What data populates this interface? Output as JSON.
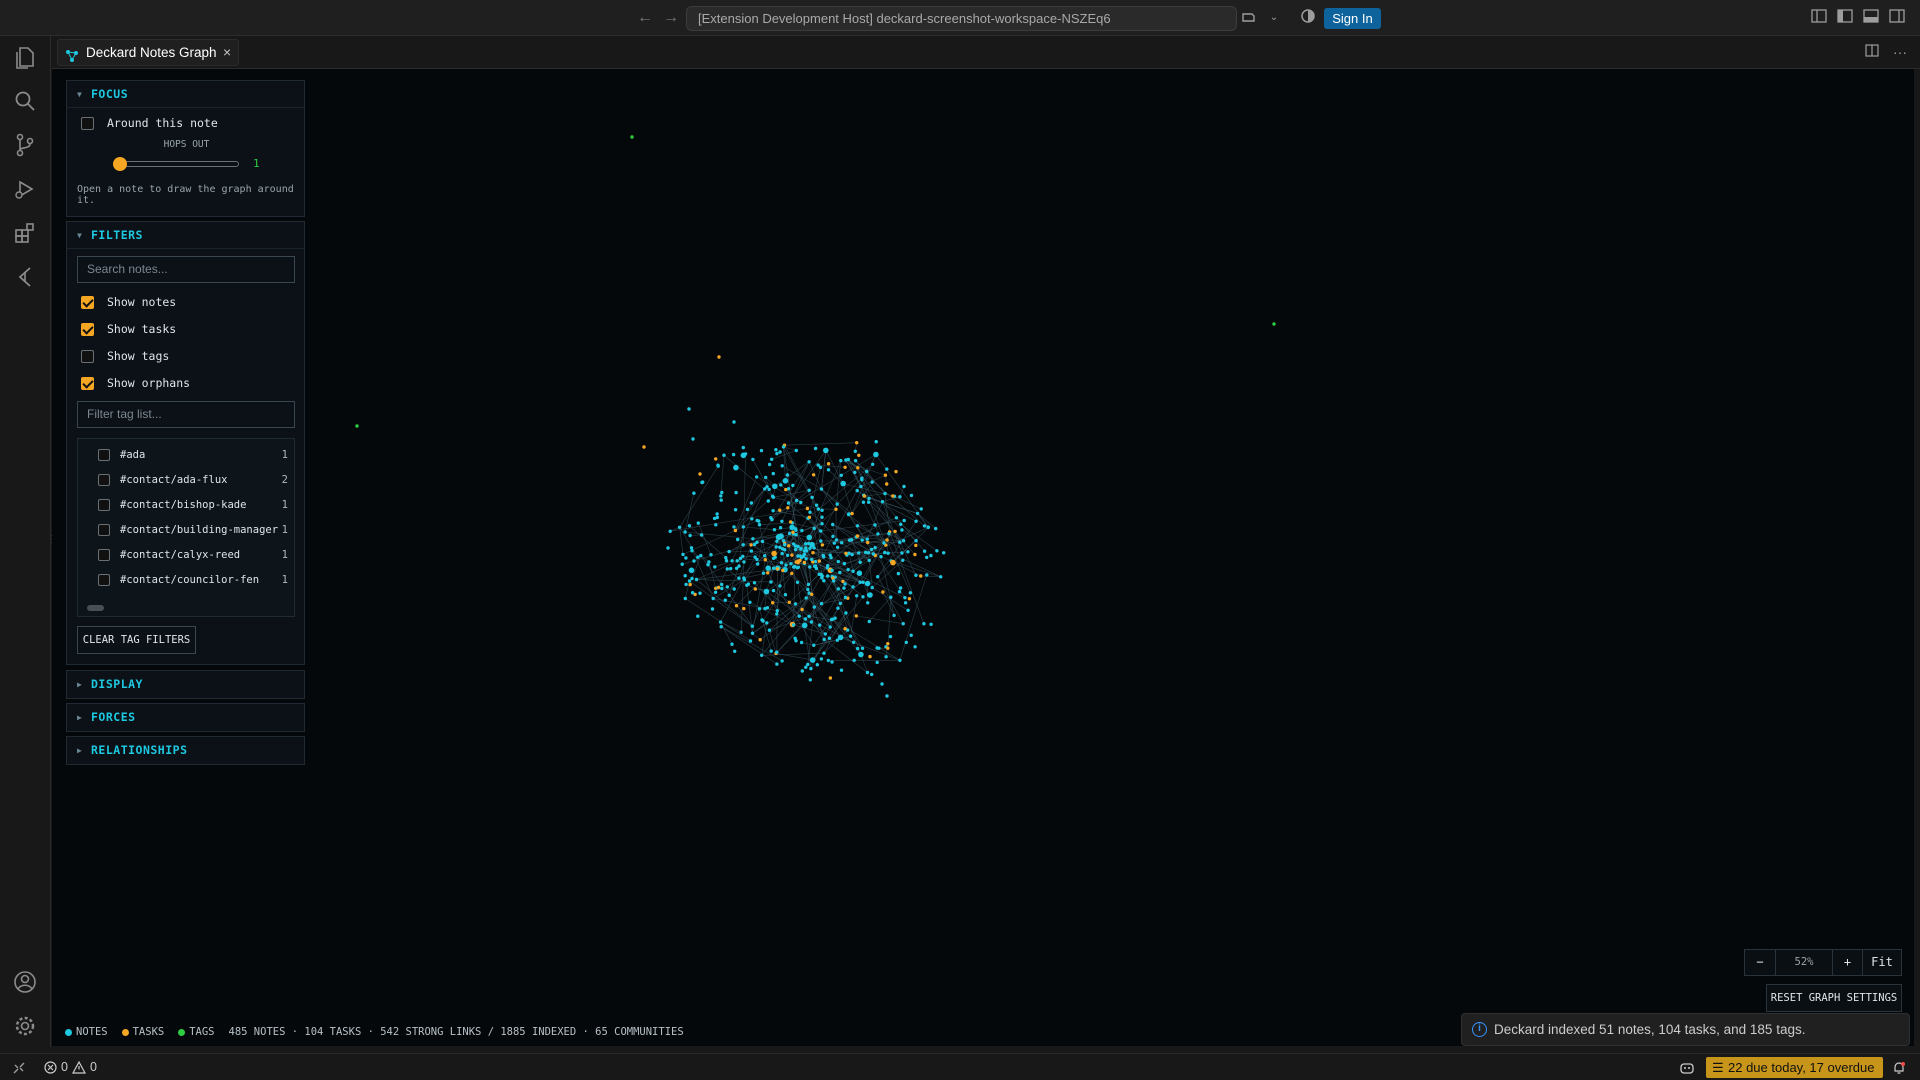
{
  "titlebar": {
    "back_icon": "arrow-left-icon",
    "forward_icon": "arrow-right-icon",
    "command_center": "[Extension Development Host] deckard-screenshot-workspace-NSZEq6",
    "sign_in": "Sign In"
  },
  "activity_bar": {
    "items": [
      "files-icon",
      "search-icon",
      "source-control-icon",
      "run-debug-icon",
      "extensions-icon",
      "deckard-icon"
    ],
    "bottom": [
      "account-icon",
      "settings-gear-icon"
    ]
  },
  "tab": {
    "label": "Deckard Notes Graph",
    "close": "×"
  },
  "focus_panel": {
    "title": "FOCUS",
    "around_label": "Around this note",
    "around_checked": false,
    "hops_label": "HOPS OUT",
    "hops_value": "1",
    "hint": "Open a note to draw the graph around it."
  },
  "filters_panel": {
    "title": "FILTERS",
    "search_placeholder": "Search notes...",
    "options": [
      {
        "label": "Show notes",
        "checked": true
      },
      {
        "label": "Show tasks",
        "checked": true
      },
      {
        "label": "Show tags",
        "checked": false
      },
      {
        "label": "Show orphans",
        "checked": true
      }
    ],
    "tag_filter_placeholder": "Filter tag list...",
    "tags": [
      {
        "name": "#ada",
        "count": "1"
      },
      {
        "name": "#contact/ada-flux",
        "count": "2"
      },
      {
        "name": "#contact/bishop-kade",
        "count": "1"
      },
      {
        "name": "#contact/building-manager",
        "count": "1"
      },
      {
        "name": "#contact/calyx-reed",
        "count": "1"
      },
      {
        "name": "#contact/councilor-fen",
        "count": "1"
      }
    ],
    "clear_button": "CLEAR TAG FILTERS"
  },
  "collapsed_panels": [
    "DISPLAY",
    "FORCES",
    "RELATIONSHIPS"
  ],
  "legend": {
    "notes": "NOTES",
    "tasks": "TASKS",
    "tags": "TAGS",
    "stats": "485 NOTES · 104 TASKS · 542 STRONG LINKS / 1885 INDEXED · 65 COMMUNITIES",
    "colors": {
      "notes": "#1ec8e0",
      "tasks": "#f5a623",
      "tags": "#2ecc40"
    }
  },
  "zoom": {
    "minus": "−",
    "level": "52%",
    "plus": "+",
    "fit": "Fit"
  },
  "reset_button": "RESET GRAPH SETTINGS",
  "toast": {
    "message": "Deckard indexed 51 notes, 104 tasks, and 185 tags."
  },
  "statusbar": {
    "errors": "0",
    "warnings": "0",
    "due": "22 due today, 17 overdue"
  }
}
